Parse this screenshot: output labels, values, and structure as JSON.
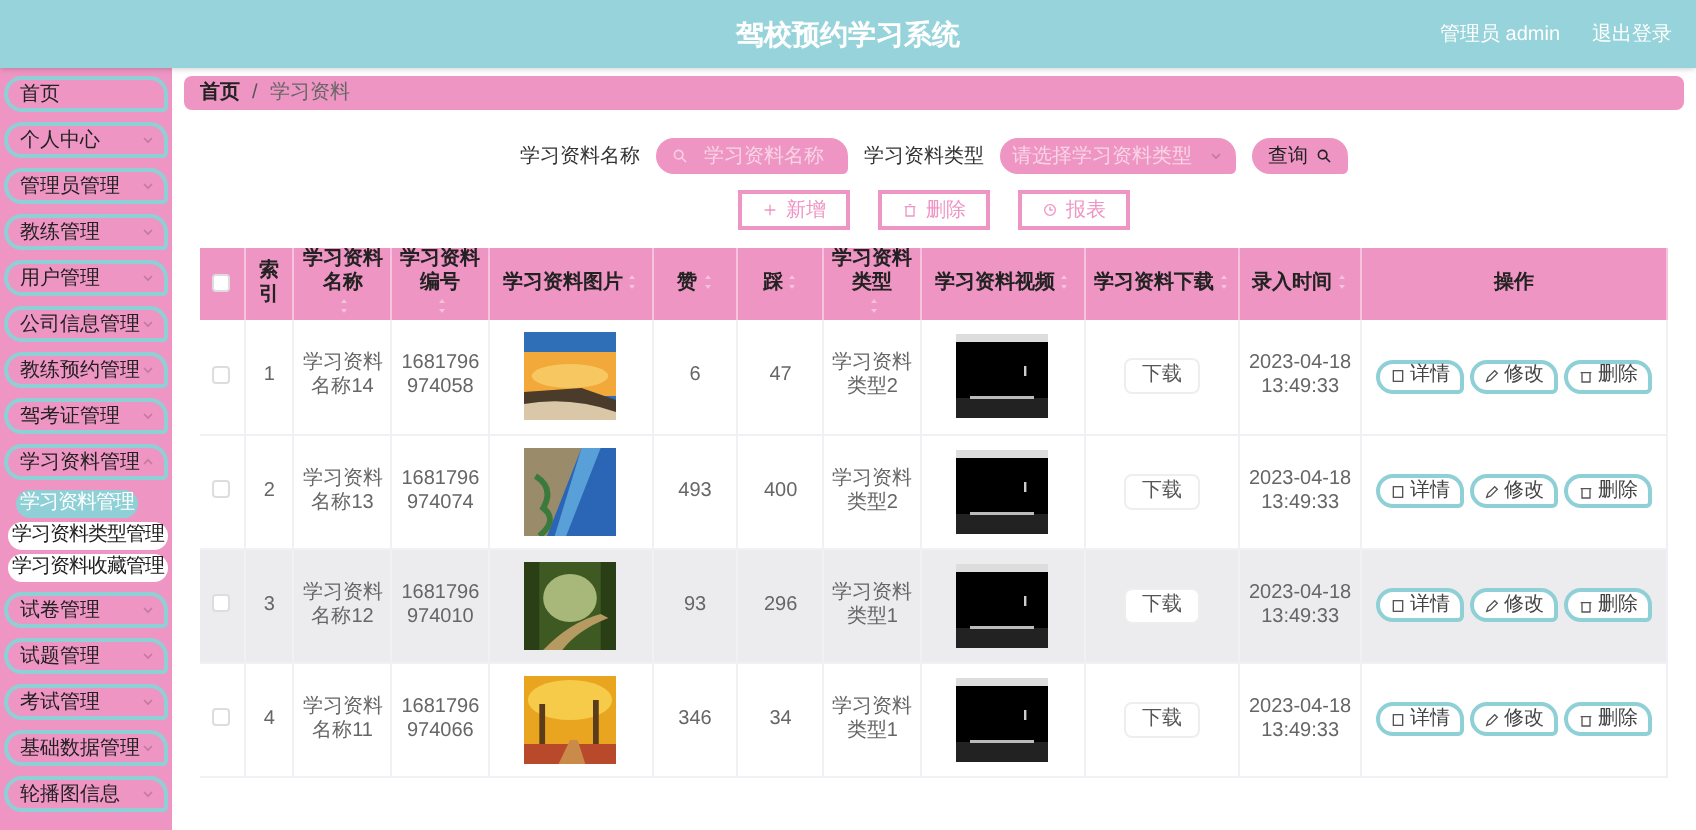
{
  "header": {
    "title": "驾校预约学习系统",
    "user": "管理员 admin",
    "logout": "退出登录"
  },
  "sidebar": {
    "items": [
      {
        "label": "首页",
        "has_arrow": false
      },
      {
        "label": "个人中心",
        "expanded": false,
        "has_arrow": true
      },
      {
        "label": "管理员管理",
        "expanded": false,
        "has_arrow": true
      },
      {
        "label": "教练管理",
        "expanded": false,
        "has_arrow": true
      },
      {
        "label": "用户管理",
        "expanded": false,
        "has_arrow": true
      },
      {
        "label": "公司信息管理",
        "expanded": false,
        "has_arrow": true
      },
      {
        "label": "教练预约管理",
        "expanded": false,
        "has_arrow": true
      },
      {
        "label": "驾考证管理",
        "expanded": false,
        "has_arrow": true
      },
      {
        "label": "学习资料管理",
        "expanded": true,
        "has_arrow": true,
        "children": [
          {
            "label": "学习资料管理",
            "selected": true
          },
          {
            "label": "学习资料类型管理",
            "selected": false
          },
          {
            "label": "学习资料收藏管理",
            "selected": false
          }
        ]
      },
      {
        "label": "试卷管理",
        "expanded": false,
        "has_arrow": true
      },
      {
        "label": "试题管理",
        "expanded": false,
        "has_arrow": true
      },
      {
        "label": "考试管理",
        "expanded": false,
        "has_arrow": true
      },
      {
        "label": "基础数据管理",
        "expanded": false,
        "has_arrow": true
      },
      {
        "label": "轮播图信息",
        "expanded": false,
        "has_arrow": true
      }
    ]
  },
  "breadcrumb": [
    "首页",
    "学习资料"
  ],
  "breadcrumb_separator": "/",
  "search": {
    "name_label": "学习资料名称",
    "name_placeholder": "学习资料名称",
    "type_label": "学习资料类型",
    "type_placeholder": "请选择学习资料类型",
    "query_button": "查询"
  },
  "actions": [
    "新增",
    "删除",
    "报表"
  ],
  "table": {
    "select_all_checked": false,
    "columns": [
      {
        "label": "索引",
        "sortable": false
      },
      {
        "label": "学习资料名称",
        "sortable": true
      },
      {
        "label": "学习资料编号",
        "sortable": true
      },
      {
        "label": "学习资料图片",
        "sortable": true
      },
      {
        "label": "赞",
        "sortable": true
      },
      {
        "label": "踩",
        "sortable": true
      },
      {
        "label": "学习资料类型",
        "sortable": true
      },
      {
        "label": "学习资料视频",
        "sortable": true
      },
      {
        "label": "学习资料下载",
        "sortable": true
      },
      {
        "label": "录入时间",
        "sortable": true
      },
      {
        "label": "操作",
        "sortable": false
      }
    ],
    "rows": [
      {
        "checked": false,
        "highlighted": false,
        "index": "1",
        "name": "学习资料名称14",
        "number": "1681796974058",
        "likes": "6",
        "dislikes": "47",
        "type": "学习资料类型2",
        "download": "下载",
        "time": "2023-04-18 13:49:33",
        "buttons": [
          "详情",
          "修改",
          "删除"
        ]
      },
      {
        "checked": false,
        "highlighted": false,
        "index": "2",
        "name": "学习资料名称13",
        "number": "1681796974074",
        "likes": "493",
        "dislikes": "400",
        "type": "学习资料类型2",
        "download": "下载",
        "time": "2023-04-18 13:49:33",
        "buttons": [
          "详情",
          "修改",
          "删除"
        ]
      },
      {
        "checked": false,
        "highlighted": true,
        "index": "3",
        "name": "学习资料名称12",
        "number": "1681796974010",
        "likes": "93",
        "dislikes": "296",
        "type": "学习资料类型1",
        "download": "下载",
        "time": "2023-04-18 13:49:33",
        "buttons": [
          "详情",
          "修改",
          "删除"
        ]
      },
      {
        "checked": false,
        "highlighted": false,
        "index": "4",
        "name": "学习资料名称11",
        "number": "1681796974066",
        "likes": "346",
        "dislikes": "34",
        "type": "学习资料类型1",
        "download": "下载",
        "time": "2023-04-18 13:49:33",
        "buttons": [
          "详情",
          "修改",
          "删除"
        ]
      }
    ]
  }
}
